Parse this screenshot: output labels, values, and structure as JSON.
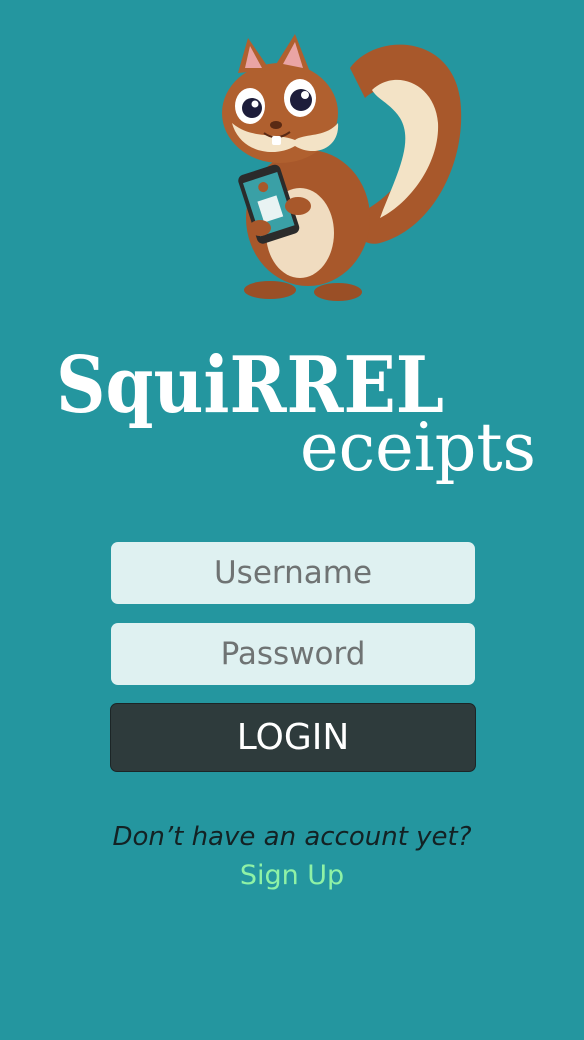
{
  "brand": {
    "logo_line1": "SquiRREL",
    "logo_line2": "eceipts",
    "logo_text_color": "#ffffff",
    "mascot_icon": "squirrel-holding-phone"
  },
  "login_form": {
    "username_placeholder": "Username",
    "password_placeholder": "Password",
    "login_label": "LOGIN"
  },
  "signup": {
    "prompt": "Don’t have an account yet?",
    "link_label": "Sign Up"
  },
  "colors": {
    "background": "#24969f",
    "field_bg": "#dff1f1",
    "button_bg": "#2e3b3c",
    "link": "#8ff2a6"
  }
}
